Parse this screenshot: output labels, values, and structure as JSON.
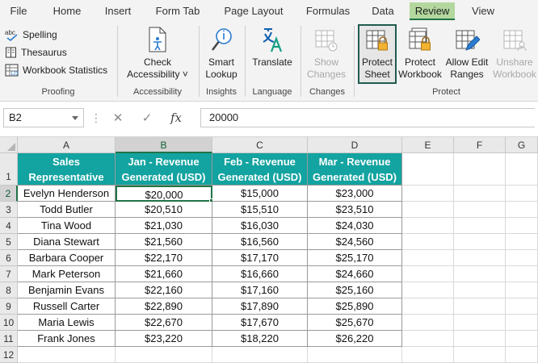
{
  "menu": {
    "tabs": [
      "File",
      "Home",
      "Insert",
      "Form Tab",
      "Page Layout",
      "Formulas",
      "Data",
      "Review",
      "View"
    ],
    "active": "Review"
  },
  "ribbon": {
    "proofing": {
      "label": "Proofing",
      "spelling": "Spelling",
      "spelling_icon_text": "abc",
      "thesaurus": "Thesaurus",
      "workbook_statistics": "Workbook Statistics",
      "stats_icon_text": "123"
    },
    "accessibility": {
      "label": "Accessibility",
      "check_line1": "Check",
      "check_line2": "Accessibility ˅"
    },
    "insights": {
      "label": "Insights",
      "smart_line1": "Smart",
      "smart_line2": "Lookup"
    },
    "language": {
      "label": "Language",
      "translate": "Translate"
    },
    "changes": {
      "label": "Changes",
      "show_line1": "Show",
      "show_line2": "Changes"
    },
    "protect": {
      "label": "Protect",
      "protect_sheet_line1": "Protect",
      "protect_sheet_line2": "Sheet",
      "protect_workbook_line1": "Protect",
      "protect_workbook_line2": "Workbook",
      "allow_edit_line1": "Allow Edit",
      "allow_edit_line2": "Ranges",
      "unshare_line1": "Unshare",
      "unshare_line2": "Workbook"
    }
  },
  "formula_bar": {
    "name_box": "B2",
    "dots": "⋮",
    "cancel": "✕",
    "enter": "✓",
    "fx": "fx",
    "value": "20000"
  },
  "grid": {
    "columns": [
      "A",
      "B",
      "C",
      "D",
      "E",
      "F",
      "G"
    ],
    "rows": [
      "1",
      "2",
      "3",
      "4",
      "5",
      "6",
      "7",
      "8",
      "9",
      "10",
      "11",
      "12"
    ],
    "active_cell": "B2",
    "headers": [
      [
        "Sales",
        "Representative"
      ],
      [
        "Jan - Revenue",
        "Generated (USD)"
      ],
      [
        "Feb - Revenue",
        "Generated (USD)"
      ],
      [
        "Mar - Revenue",
        "Generated (USD)"
      ]
    ],
    "data": [
      [
        "Evelyn Henderson",
        "$20,000",
        "$15,000",
        "$23,000"
      ],
      [
        "Todd Butler",
        "$20,510",
        "$15,510",
        "$23,510"
      ],
      [
        "Tina Wood",
        "$21,030",
        "$16,030",
        "$24,030"
      ],
      [
        "Diana Stewart",
        "$21,560",
        "$16,560",
        "$24,560"
      ],
      [
        "Barbara Cooper",
        "$22,170",
        "$17,170",
        "$25,170"
      ],
      [
        "Mark Peterson",
        "$21,660",
        "$16,660",
        "$24,660"
      ],
      [
        "Benjamin Evans",
        "$22,160",
        "$17,160",
        "$25,160"
      ],
      [
        "Russell Carter",
        "$22,890",
        "$17,890",
        "$25,890"
      ],
      [
        "Maria Lewis",
        "$22,670",
        "$17,670",
        "$25,670"
      ],
      [
        "Frank Jones",
        "$23,220",
        "$18,220",
        "$26,220"
      ]
    ]
  }
}
